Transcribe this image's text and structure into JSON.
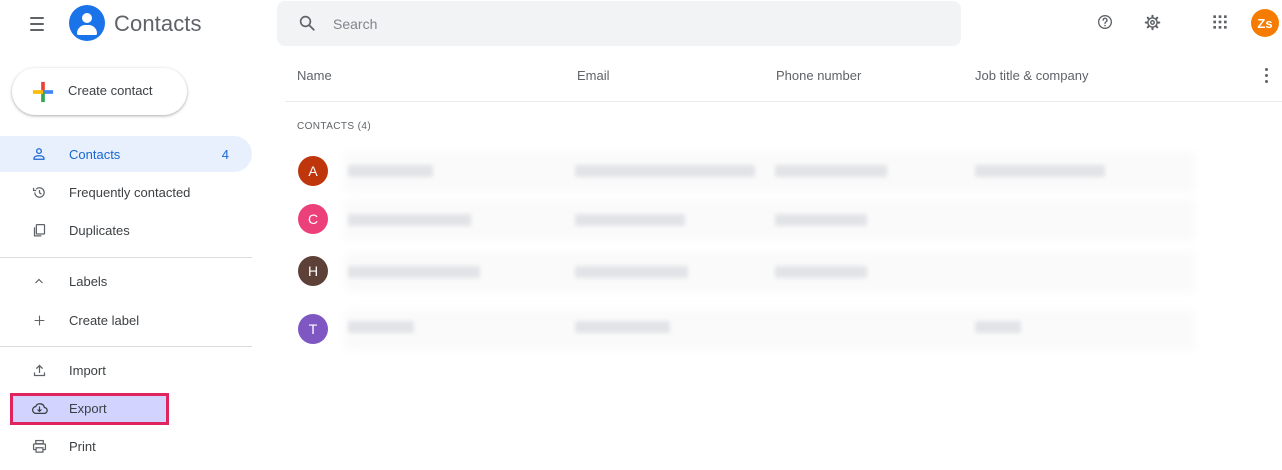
{
  "header": {
    "app_title": "Contacts",
    "search_placeholder": "Search",
    "avatar_initials": "Zs",
    "avatar_color": "#f57c00",
    "icons": [
      "menu-icon",
      "contacts-logo-icon",
      "search-icon",
      "help-icon",
      "gear-icon",
      "apps-icon"
    ]
  },
  "sidebar": {
    "create_contact_label": "Create contact",
    "items": [
      {
        "label": "Contacts",
        "count": "4",
        "icon": "person-icon",
        "active": true
      },
      {
        "label": "Frequently contacted",
        "icon": "history-icon"
      },
      {
        "label": "Duplicates",
        "icon": "copy-icon"
      },
      {
        "label": "Labels",
        "icon": "chevron-up-icon"
      },
      {
        "label": "Create label",
        "icon": "plus-icon"
      },
      {
        "label": "Import",
        "icon": "upload-icon"
      },
      {
        "label": "Export",
        "icon": "cloud-download-icon",
        "highlighted": true
      },
      {
        "label": "Print",
        "icon": "print-icon"
      }
    ]
  },
  "table": {
    "columns": [
      "Name",
      "Email",
      "Phone number",
      "Job title & company"
    ],
    "section_label": "CONTACTS (4)",
    "rows": [
      {
        "initial": "A",
        "color": "#bf360c"
      },
      {
        "initial": "C",
        "color": "#ec407a"
      },
      {
        "initial": "H",
        "color": "#5d4037"
      },
      {
        "initial": "T",
        "color": "#7e57c2"
      }
    ]
  },
  "colors": {
    "accent": "#1a73e8",
    "active_nav_bg": "#e8f0fe",
    "highlight_border": "#e0245e",
    "highlight_fill": "#d2d4ff"
  }
}
